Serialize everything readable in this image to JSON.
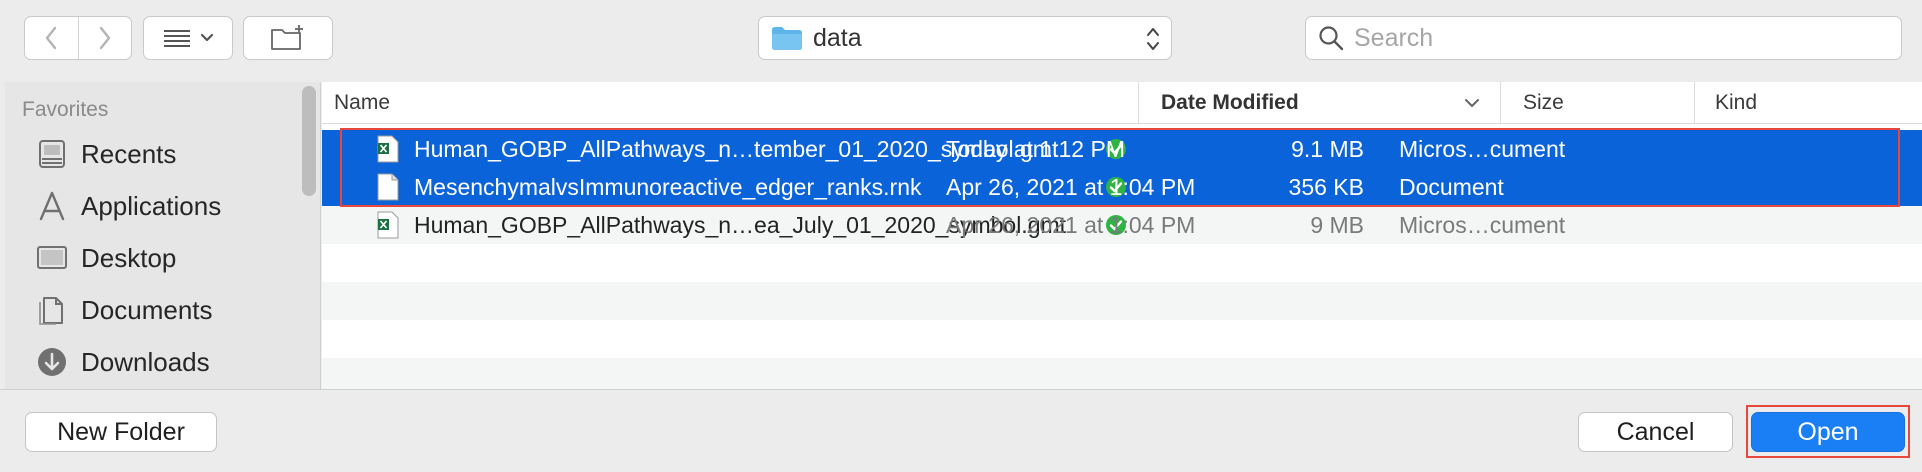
{
  "toolbar": {
    "path_label": "data",
    "search_placeholder": "Search"
  },
  "sidebar": {
    "heading": "Favorites",
    "items": [
      {
        "label": "Recents",
        "icon": "recents-icon"
      },
      {
        "label": "Applications",
        "icon": "applications-icon"
      },
      {
        "label": "Desktop",
        "icon": "desktop-icon"
      },
      {
        "label": "Documents",
        "icon": "documents-icon"
      },
      {
        "label": "Downloads",
        "icon": "downloads-icon"
      }
    ]
  },
  "columns": {
    "name": "Name",
    "date": "Date Modified",
    "size": "Size",
    "kind": "Kind"
  },
  "files": [
    {
      "name": "Human_GOBP_AllPathways_n…tember_01_2020_symbol.gmt",
      "date": "Today at 1:12 PM",
      "size": "9.1 MB",
      "kind": "Micros…cument",
      "icon": "excel-file-icon",
      "selected": true
    },
    {
      "name": "MesenchymalvsImmunoreactive_edger_ranks.rnk",
      "date": "Apr 26, 2021 at 1:04 PM",
      "size": "356 KB",
      "kind": "Document",
      "icon": "document-file-icon",
      "selected": true
    },
    {
      "name": "Human_GOBP_AllPathways_n…ea_July_01_2020_symbol.gmt",
      "date": "Apr 26, 2021 at 1:04 PM",
      "size": "9 MB",
      "kind": "Micros…cument",
      "icon": "excel-file-icon",
      "selected": false
    }
  ],
  "buttons": {
    "new_folder": "New Folder",
    "cancel": "Cancel",
    "open": "Open"
  },
  "colors": {
    "selection": "#0b63d9",
    "primary_button": "#1a7ef5",
    "annotation_box": "#e8473b",
    "sync_check": "#2fb344"
  }
}
